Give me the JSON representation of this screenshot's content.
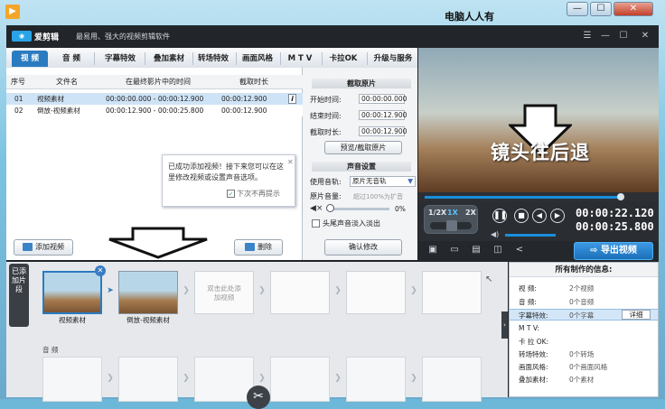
{
  "outer": {
    "caption": "电脑人人有",
    "minimize": "—",
    "maximize": "☐",
    "close": "✕"
  },
  "app": {
    "name": "爱剪辑",
    "slogan": "最易用、强大的视频剪辑软件",
    "window_controls": [
      "☰",
      "—",
      "☐",
      "✕"
    ]
  },
  "tabs": [
    "视 频",
    "音 频",
    "字幕特效",
    "叠加素材",
    "转场特效",
    "画面风格",
    "M T V",
    "卡拉OK",
    "升级与服务"
  ],
  "clip_table": {
    "headers": [
      "序号",
      "文件名",
      "在最终影片中的时间",
      "截取时长"
    ],
    "rows": [
      {
        "no": "01",
        "name": "视频素材",
        "range": "00:00:00.000 - 00:00:12.900",
        "duration": "00:00:12.900"
      },
      {
        "no": "02",
        "name": "倒放-视频素材",
        "range": "00:00:12.900 - 00:00:25.800",
        "duration": "00:00:12.900"
      }
    ],
    "info_button": "i"
  },
  "tooltip": {
    "text": "已成功添加视频！接下来您可以在这里修改视频或设置声音选项。",
    "close": "✕",
    "checkbox_label": "下次不再提示",
    "checked": "✓"
  },
  "buttons": {
    "add_video": "添加视频",
    "delete": "删除"
  },
  "settings": {
    "trim_title": "截取原片",
    "start_label": "开始时间:",
    "start_value": "00:00:00.000",
    "end_label": "结束时间:",
    "end_value": "00:00:12.900",
    "dur_label": "截取时长:",
    "dur_value": "00:00:12.900",
    "preview_trim_button": "预览/截取原片",
    "sound_title": "声音设置",
    "track_label": "使用音轨:",
    "track_value": "原片无音轨",
    "volume_label": "原片音量:",
    "volume_hint": "超过100%为扩音",
    "volume_value": "0%",
    "fade_label": "头尾声音淡入淡出",
    "confirm_button": "确认修改"
  },
  "preview": {
    "caption": "镜头往后退",
    "progress": 0.86,
    "speeds": [
      "1/2X",
      "1X",
      "2X"
    ],
    "time_current": "00:00:22.120",
    "time_total": "00:00:25.800",
    "export_button": "导出视频"
  },
  "timeline": {
    "added_label": "已添加片段",
    "clips": [
      {
        "caption": "视频素材"
      },
      {
        "caption": "倒放-视频素材"
      }
    ],
    "placeholder": "双击此处添加视频",
    "audio_label": "音 频"
  },
  "info": {
    "title": "所有制作的信息:",
    "items": [
      {
        "label": "视 频:",
        "value": "2个视频"
      },
      {
        "label": "音 频:",
        "value": "0个音频"
      },
      {
        "label": "字幕特效:",
        "value": "0个字幕"
      },
      {
        "label": "M T V:",
        "value": ""
      },
      {
        "label": "卡 拉 OK:",
        "value": ""
      },
      {
        "label": "转场特效:",
        "value": "0个转场"
      },
      {
        "label": "画面风格:",
        "value": "0个画面风格"
      },
      {
        "label": "叠加素材:",
        "value": "0个素材"
      }
    ],
    "detail_button": "详细"
  },
  "colors": {
    "accent": "#2b7bc0",
    "selected_row": "#cfe3f6",
    "export": "#1c6fb8",
    "app_bg": "#1f2226"
  }
}
